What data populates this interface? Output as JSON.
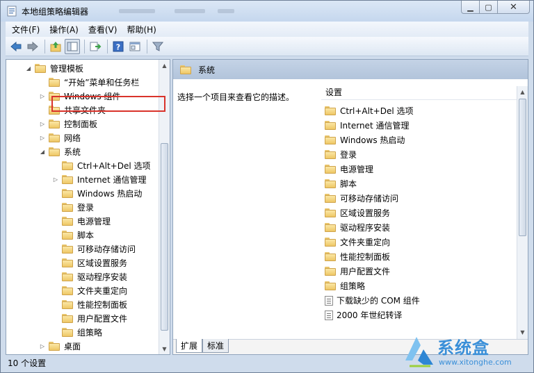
{
  "window": {
    "title": "本地组策略编辑器"
  },
  "menubar": [
    "文件(F)",
    "操作(A)",
    "查看(V)",
    "帮助(H)"
  ],
  "toolbar": [
    "back-icon",
    "forward-icon",
    "up-folder-icon",
    "show-tree-icon",
    "export-icon",
    "help-icon",
    "properties-icon",
    "filter-icon"
  ],
  "tree": [
    {
      "label": "管理模板",
      "arrow": "◢"
    },
    {
      "label": "“开始”菜单和任务栏",
      "arrow": ""
    },
    {
      "label": "Windows 组件",
      "arrow": "▷"
    },
    {
      "label": "共享文件夹",
      "arrow": ""
    },
    {
      "label": "控制面板",
      "arrow": "▷"
    },
    {
      "label": "网络",
      "arrow": "▷"
    },
    {
      "label": "系统",
      "arrow": "◢"
    },
    {
      "label": "Ctrl+Alt+Del 选项",
      "arrow": ""
    },
    {
      "label": "Internet 通信管理",
      "arrow": "▷"
    },
    {
      "label": "Windows 热启动",
      "arrow": ""
    },
    {
      "label": "登录",
      "arrow": ""
    },
    {
      "label": "电源管理",
      "arrow": ""
    },
    {
      "label": "脚本",
      "arrow": ""
    },
    {
      "label": "可移动存储访问",
      "arrow": ""
    },
    {
      "label": "区域设置服务",
      "arrow": ""
    },
    {
      "label": "驱动程序安装",
      "arrow": ""
    },
    {
      "label": "文件夹重定向",
      "arrow": ""
    },
    {
      "label": "性能控制面板",
      "arrow": ""
    },
    {
      "label": "用户配置文件",
      "arrow": ""
    },
    {
      "label": "组策略",
      "arrow": ""
    },
    {
      "label": "桌面",
      "arrow": "▷"
    }
  ],
  "right": {
    "header": "系统",
    "description": "选择一个项目来查看它的描述。",
    "column_header": "设置",
    "items": [
      {
        "label": "Ctrl+Alt+Del 选项",
        "type": "folder"
      },
      {
        "label": "Internet 通信管理",
        "type": "folder"
      },
      {
        "label": "Windows 热启动",
        "type": "folder"
      },
      {
        "label": "登录",
        "type": "folder"
      },
      {
        "label": "电源管理",
        "type": "folder"
      },
      {
        "label": "脚本",
        "type": "folder"
      },
      {
        "label": "可移动存储访问",
        "type": "folder"
      },
      {
        "label": "区域设置服务",
        "type": "folder"
      },
      {
        "label": "驱动程序安装",
        "type": "folder"
      },
      {
        "label": "文件夹重定向",
        "type": "folder"
      },
      {
        "label": "性能控制面板",
        "type": "folder"
      },
      {
        "label": "用户配置文件",
        "type": "folder"
      },
      {
        "label": "组策略",
        "type": "folder"
      },
      {
        "label": "下载缺少的 COM 组件",
        "type": "policy"
      },
      {
        "label": "2000 年世纪转译",
        "type": "policy"
      }
    ],
    "tabs": [
      "扩展",
      "标准"
    ]
  },
  "status": "10 个设置",
  "watermark": {
    "name": "系统盒",
    "url": "www.xitonghe.com"
  }
}
